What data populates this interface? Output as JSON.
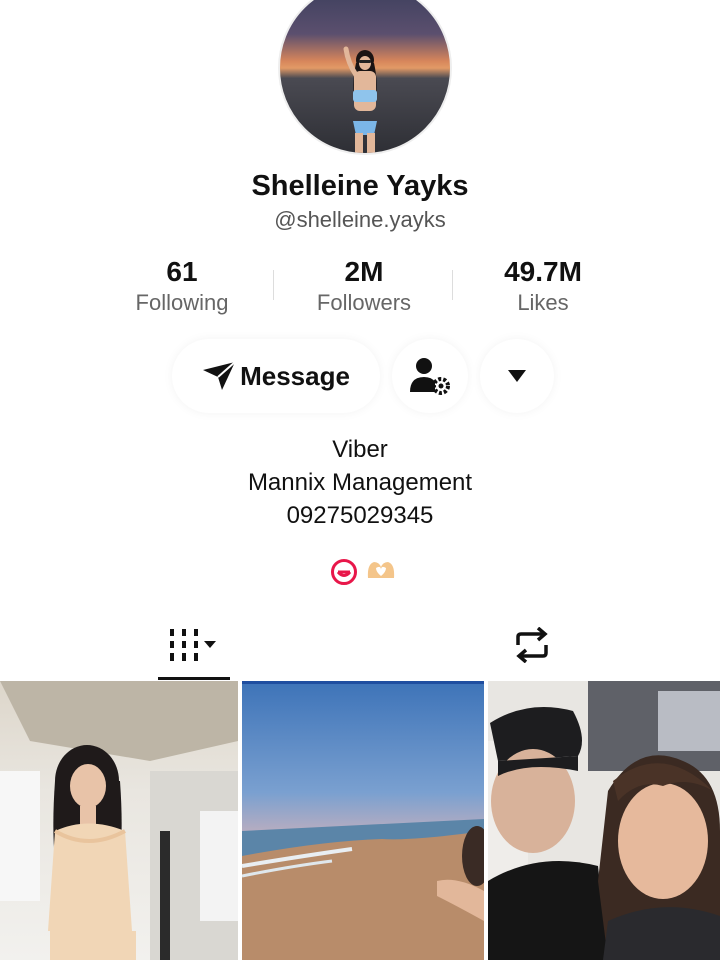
{
  "profile": {
    "display_name": "Shelleine Yayks",
    "username": "@shelleine.yayks"
  },
  "stats": [
    {
      "value": "61",
      "label": "Following"
    },
    {
      "value": "2M",
      "label": "Followers"
    },
    {
      "value": "49.7M",
      "label": "Likes"
    }
  ],
  "actions": {
    "message_label": "Message"
  },
  "bio": {
    "lines": [
      "Viber",
      "Mannix Management",
      "09275029345"
    ]
  },
  "tabs": {
    "videos_icon": "grid-icon",
    "reposts_icon": "repost-icon"
  },
  "colors": {
    "accent": "#e8174a",
    "text": "#111111",
    "muted": "#666666"
  }
}
